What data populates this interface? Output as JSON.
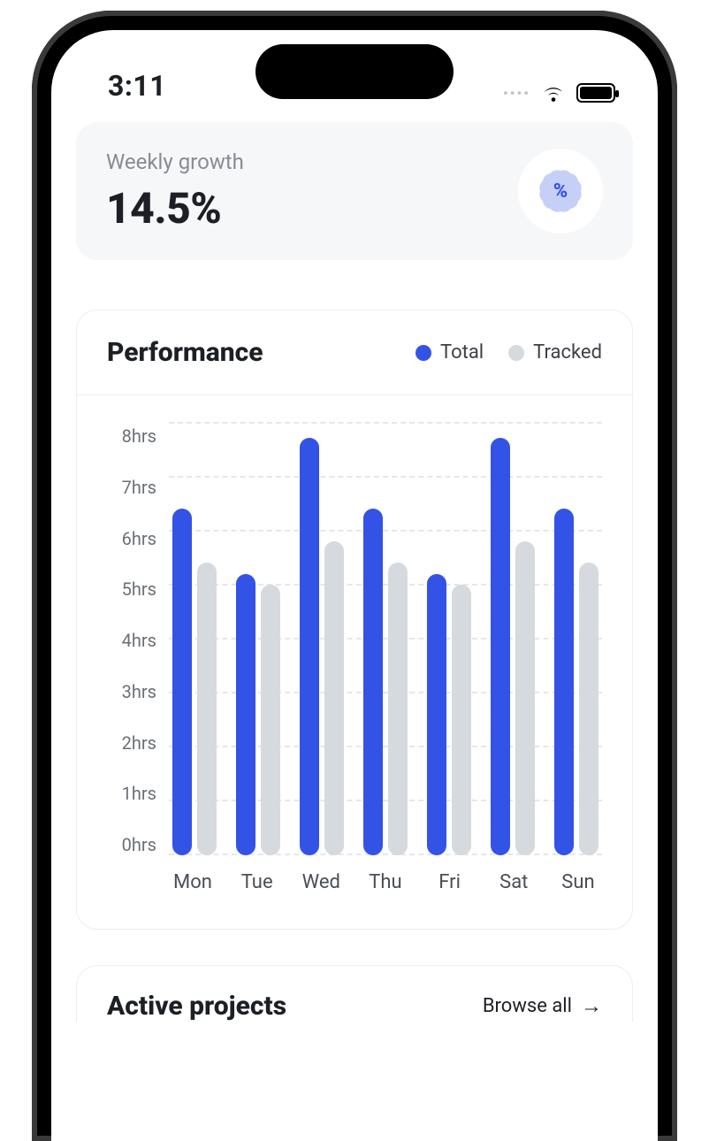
{
  "status": {
    "time": "3:11"
  },
  "growth": {
    "label": "Weekly growth",
    "value": "14.5%",
    "icon_glyph": "%"
  },
  "performance": {
    "title": "Performance",
    "legend": {
      "total": "Total",
      "tracked": "Tracked"
    }
  },
  "projects": {
    "title": "Active projects",
    "browse": "Browse all"
  },
  "colors": {
    "blue": "#3353e6",
    "grey": "#d6d9de"
  },
  "chart_data": {
    "type": "bar",
    "title": "Performance",
    "xlabel": "",
    "ylabel": "hrs",
    "ylim": [
      0,
      8
    ],
    "y_ticks": [
      "8hrs",
      "7hrs",
      "6hrs",
      "5hrs",
      "4hrs",
      "3hrs",
      "2hrs",
      "1hrs",
      "0hrs"
    ],
    "categories": [
      "Mon",
      "Tue",
      "Wed",
      "Thu",
      "Fri",
      "Sat",
      "Sun"
    ],
    "series": [
      {
        "name": "Total",
        "values": [
          6.4,
          5.2,
          7.7,
          6.4,
          5.2,
          7.7,
          6.4
        ]
      },
      {
        "name": "Tracked",
        "values": [
          5.4,
          5.0,
          5.8,
          5.4,
          5.0,
          5.8,
          5.4
        ]
      }
    ]
  }
}
